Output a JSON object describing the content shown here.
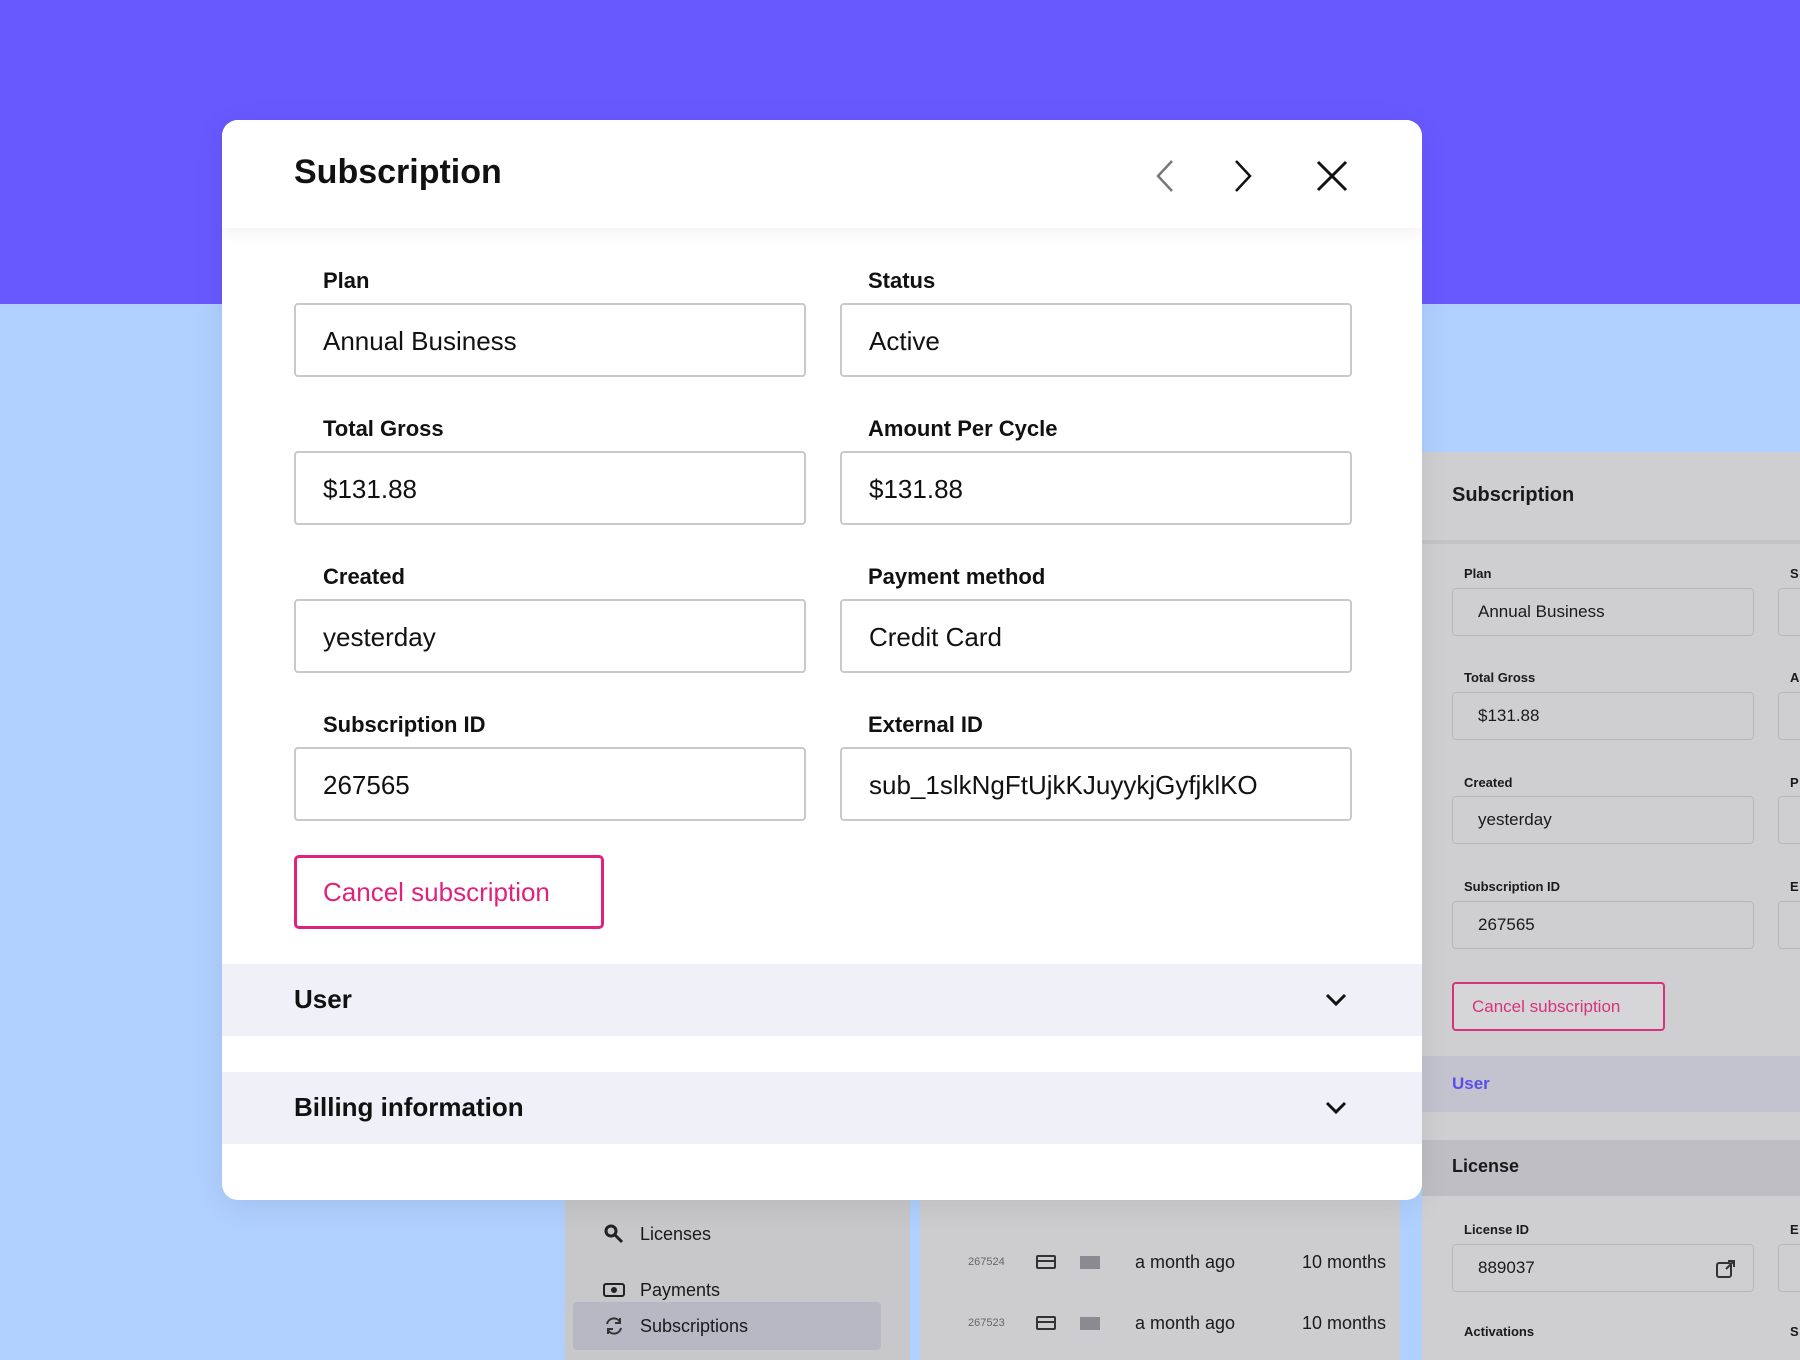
{
  "modal": {
    "title": "Subscription",
    "fields": {
      "plan": {
        "label": "Plan",
        "value": "Annual Business"
      },
      "status": {
        "label": "Status",
        "value": "Active"
      },
      "total_gross": {
        "label": "Total Gross",
        "value": "$131.88"
      },
      "amount_per_cycle": {
        "label": "Amount Per Cycle",
        "value": "$131.88"
      },
      "created": {
        "label": "Created",
        "value": "yesterday"
      },
      "payment_method": {
        "label": "Payment method",
        "value": "Credit Card"
      },
      "subscription_id": {
        "label": "Subscription ID",
        "value": "267565"
      },
      "external_id": {
        "label": "External ID",
        "value": "sub_1slkNgFtUjkKJuyykjGyfjklKO"
      }
    },
    "cancel_label": "Cancel subscription",
    "sections": {
      "user": "User",
      "billing": "Billing information"
    },
    "icons": {
      "prev": "chevron-left-icon",
      "next": "chevron-right-icon",
      "close": "close-icon",
      "expand": "chevron-down-icon"
    }
  },
  "background_panel": {
    "title": "Subscription",
    "plan": {
      "label": "Plan",
      "value": "Annual Business"
    },
    "total_gross": {
      "label": "Total Gross",
      "value": "$131.88"
    },
    "created": {
      "label": "Created",
      "value": "yesterday"
    },
    "subscription_id": {
      "label": "Subscription ID",
      "value": "267565"
    },
    "col2_labels": [
      "S",
      "A",
      "P",
      "E"
    ],
    "cancel_label": "Cancel subscription",
    "user_section": "User",
    "license_section": "License",
    "license_id": {
      "label": "License ID",
      "value": "889037"
    },
    "activations_label": "Activations",
    "stub_labels": [
      "E",
      "S"
    ]
  },
  "sidebar": {
    "items": [
      {
        "label": "Licenses",
        "icon": "key-icon"
      },
      {
        "label": "Payments",
        "icon": "money-icon"
      },
      {
        "label": "Subscriptions",
        "icon": "refresh-icon"
      }
    ]
  },
  "table": {
    "rows": [
      {
        "id": "267524",
        "when": "a month ago",
        "duration": "10 months"
      },
      {
        "id": "267523",
        "when": "a month ago",
        "duration": "10 months"
      }
    ]
  },
  "colors": {
    "brand_purple": "#6859ff",
    "light_blue": "#b0d0ff",
    "cancel_pink": "#e0217e",
    "accordion_bg": "#f0f0f9"
  }
}
